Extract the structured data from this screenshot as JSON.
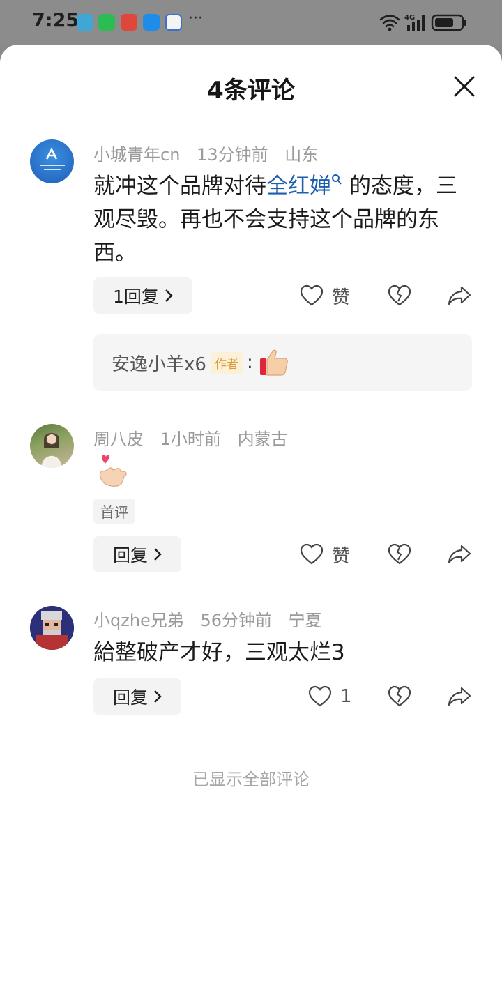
{
  "status_bar": {
    "time": "7:25",
    "more": "···",
    "signal_label": "4G"
  },
  "header": {
    "title": "4条评论"
  },
  "comments": [
    {
      "username": "小城青年cn",
      "time": "13分钟前",
      "location": "山东",
      "text_before": "就冲这个品牌对待",
      "link": "全红婵",
      "text_after": "的态度，三观尽毁。再也不会支持这个品牌的东西。",
      "reply_label": "1回复",
      "like_label": "赞",
      "sub_reply": {
        "username": "安逸小羊x6",
        "badge": "作者",
        "colon": ":"
      }
    },
    {
      "username": "周八皮",
      "time": "1小时前",
      "location": "内蒙古",
      "tag": "首评",
      "reply_label": "回复",
      "like_label": "赞"
    },
    {
      "username": "小qzhe兄弟",
      "time": "56分钟前",
      "location": "宁夏",
      "text": "給整破产才好，三观太烂3",
      "reply_label": "回复",
      "like_label": "1"
    }
  ],
  "footer": "已显示全部评论"
}
